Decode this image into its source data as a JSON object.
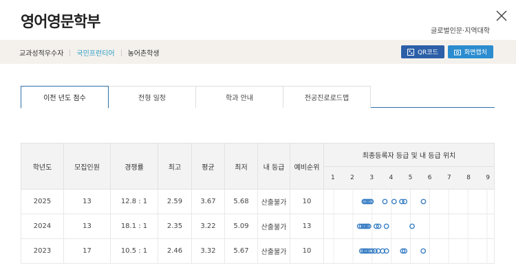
{
  "header": {
    "title": "영어영문학부",
    "college": "글로벌인문·지역대학"
  },
  "breadcrumbs": [
    {
      "label": "교과성적우수자",
      "active": false
    },
    {
      "label": "국민프런티어",
      "active": true
    },
    {
      "label": "농어촌학생",
      "active": false
    }
  ],
  "buttons": {
    "qr": "QR코드",
    "capture": "화면캡처"
  },
  "tabs": [
    {
      "label": "이전 년도 점수",
      "active": true
    },
    {
      "label": "전형 일정",
      "active": false
    },
    {
      "label": "학과 안내",
      "active": false
    },
    {
      "label": "전공진로로드맵",
      "active": false
    }
  ],
  "table": {
    "headers": [
      "학년도",
      "모집인원",
      "경쟁률",
      "최고",
      "평균",
      "최저",
      "내 등급",
      "예비순위"
    ],
    "plot_header": "최종등록자 등급 및 내 등급 위치",
    "grade_scale": [
      "1",
      "2",
      "3",
      "4",
      "5",
      "6",
      "7",
      "8",
      "9"
    ],
    "rows": [
      {
        "year": "2025",
        "quota": "13",
        "ratio": "12.8 : 1",
        "max": "2.59",
        "avg": "3.67",
        "min": "5.68",
        "mine": "산출불가",
        "reserve": "10"
      },
      {
        "year": "2024",
        "quota": "13",
        "ratio": "18.1 : 1",
        "max": "2.35",
        "avg": "3.22",
        "min": "5.09",
        "mine": "산출불가",
        "reserve": "13"
      },
      {
        "year": "2023",
        "quota": "17",
        "ratio": "10.5 : 1",
        "max": "2.46",
        "avg": "3.32",
        "min": "5.67",
        "mine": "산출불가",
        "reserve": "10"
      }
    ]
  },
  "dots": [
    {
      "grades": [
        2.59,
        2.65,
        2.72,
        2.8,
        2.88,
        2.95,
        3.67,
        4.15,
        4.55,
        4.7,
        5.68
      ]
    },
    {
      "grades": [
        2.35,
        2.45,
        2.55,
        2.62,
        2.68,
        2.75,
        2.82,
        3.22,
        3.35,
        3.75,
        5.09
      ]
    },
    {
      "grades": [
        2.46,
        2.55,
        2.63,
        2.7,
        2.78,
        2.9,
        3.0,
        3.15,
        3.32,
        3.55,
        3.75,
        4.6,
        4.7,
        5.67
      ]
    }
  ],
  "colors": {
    "accent": "#2c6ea8",
    "dot": "#3a7fc4",
    "active_crumb": "#2a9bc4"
  }
}
